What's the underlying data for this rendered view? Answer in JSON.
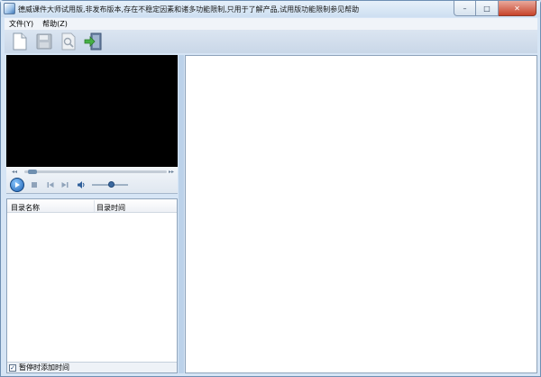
{
  "window": {
    "title": "德威课件大师试用版,非发布版本,存在不稳定因素和诸多功能限制,只用于了解产品,试用版功能限制参见帮助",
    "controls": {
      "minimize": "–",
      "maximize": "□",
      "close": "✕"
    }
  },
  "menu": [
    {
      "label": "文件(Y)"
    },
    {
      "label": "帮助(Z)"
    }
  ],
  "toolbar": [
    {
      "icon": "new-file-icon"
    },
    {
      "icon": "save-icon"
    },
    {
      "icon": "preview-icon"
    },
    {
      "icon": "exit-icon"
    }
  ],
  "player": {
    "seek_position": 0.02,
    "volume": 0.5
  },
  "list": {
    "columns": [
      "目录名称",
      "目录时间"
    ],
    "rows": []
  },
  "footer": {
    "checkbox_checked": true,
    "checkbox_label": "暂停时添加时间"
  }
}
